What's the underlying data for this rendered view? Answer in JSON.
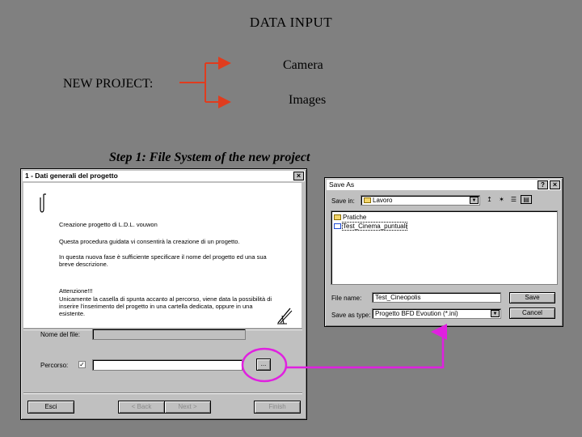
{
  "slide": {
    "title": "DATA INPUT",
    "new_project_label": "NEW PROJECT:",
    "branch_camera": "Camera",
    "branch_images": "Images",
    "step_caption": "Step 1: File System of the new project",
    "arrow_color": "#e03c1e",
    "highlight_color": "#e020e0"
  },
  "wizard": {
    "title": "1 - Dati generali del progetto",
    "heading": "Creazione progetto di L.D.L. vouwon",
    "intro": "Questa procedura guidata vi consentirà la creazione di un progetto.",
    "instruction": "In questa nuova fase è sufficiente specificare il nome del progetto ed una sua breve descrizione.",
    "warning_title": "Attenzione!!!",
    "warning_text": "Unicamente la casella di spunta accanto al percorso, viene data la possibilità di inserire l'inserimento del progetto in una cartella dedicata, oppure in una esistente.",
    "file_name_label": "Nome del file:",
    "file_name_value": "",
    "path_label": "Percorso:",
    "path_checked": "✓",
    "path_value": "",
    "browse_label": "...",
    "buttons": {
      "exit": "Esci",
      "back": "< Back",
      "next": "Next >",
      "finish": "Finish"
    }
  },
  "save_as": {
    "title": "Save As",
    "save_in_label": "Save in:",
    "save_in_value": "Lavoro",
    "files": [
      {
        "name": "Pratiche",
        "type": "folder"
      },
      {
        "name": "Test_Cinema_puntuali",
        "type": "file"
      }
    ],
    "file_name_label": "File name:",
    "file_name_value": "Test_Cineopolis",
    "save_type_label": "Save as type:",
    "save_type_value": "Progetto BFD Evoution (*.ini)",
    "save_button": "Save",
    "cancel_button": "Cancel",
    "help_label": "?",
    "close_label": "×"
  }
}
